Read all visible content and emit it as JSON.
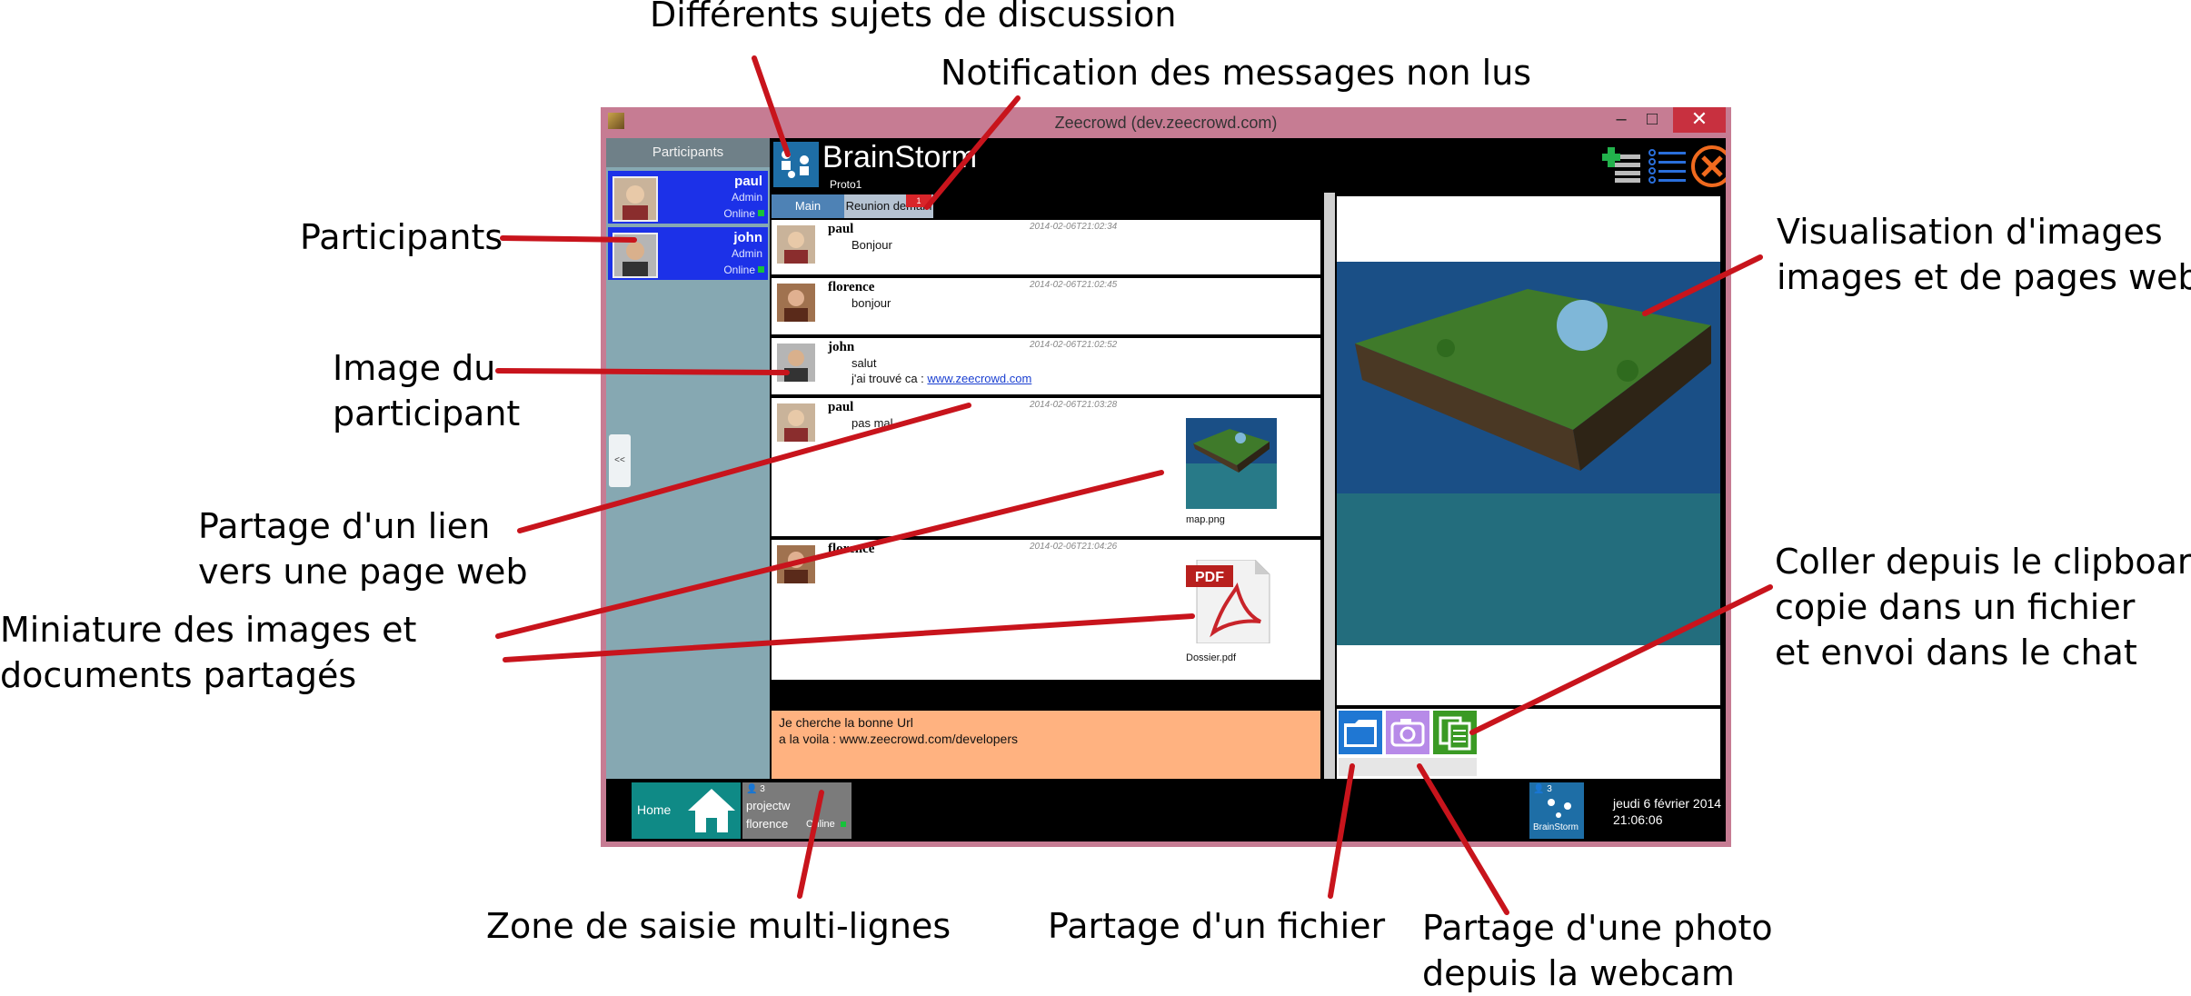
{
  "annotations": {
    "topics": "Différents sujets de discussion",
    "unread": "Notification des messages non lus",
    "participants": "Participants",
    "avatar": [
      "Image du",
      "participant"
    ],
    "link": [
      "Partage d'un lien",
      "vers une page web"
    ],
    "thumbs": [
      "Miniature des images et",
      "documents partagés"
    ],
    "viewer": [
      "Visualisation d'images",
      "images et de pages web"
    ],
    "clipboard": [
      "Coller depuis le clipboard,",
      "copie dans un fichier",
      "et envoi dans le chat"
    ],
    "input": "Zone de saisie multi-lignes",
    "file": "Partage d'un fichier",
    "webcam": [
      "Partage d'une photo",
      "depuis la webcam"
    ]
  },
  "window": {
    "title": "Zeecrowd (dev.zeecrowd.com)"
  },
  "sidebar": {
    "header": "Participants",
    "participants": [
      {
        "name": "paul",
        "role": "Admin",
        "status": "Online"
      },
      {
        "name": "john",
        "role": "Admin",
        "status": "Online"
      }
    ],
    "collapse_label": "<<"
  },
  "header": {
    "title": "BrainStorm",
    "subtitle": "Proto1"
  },
  "tabs": [
    {
      "label": "Main"
    },
    {
      "label": "Reunion demain",
      "badge": "1"
    }
  ],
  "messages": [
    {
      "author": "paul",
      "time": "2014-02-06T21:02:34",
      "lines": [
        "Bonjour"
      ]
    },
    {
      "author": "florence",
      "time": "2014-02-06T21:02:45",
      "lines": [
        "bonjour"
      ]
    },
    {
      "author": "john",
      "time": "2014-02-06T21:02:52",
      "lines": [
        "salut"
      ],
      "link_prefix": "j'ai trouvé ca : ",
      "link": "www.zeecrowd.com"
    },
    {
      "author": "paul",
      "time": "2014-02-06T21:03:28",
      "lines": [
        "pas mal"
      ],
      "attachment": "map.png"
    },
    {
      "author": "florence",
      "time": "2014-02-06T21:04:26",
      "lines": [],
      "attachment": "Dossier.pdf"
    }
  ],
  "input": {
    "line1": "Je cherche la bonne Url",
    "line2": "a la voila : www.zeecrowd.com/developers"
  },
  "taskbar": {
    "home": "Home",
    "project": {
      "count": "3",
      "name": "projectw",
      "user": "florence",
      "status": "Online"
    },
    "brainstorm": {
      "count": "3",
      "label": "BrainStorm"
    },
    "date": "jeudi 6 février 2014",
    "time": "21:06:06"
  },
  "icons": {
    "share_file": "folder-icon",
    "webcam": "camera-icon",
    "paste": "clipboard-icon",
    "add_participant": "add-user-icon",
    "list": "list-icon",
    "close": "close-icon"
  }
}
